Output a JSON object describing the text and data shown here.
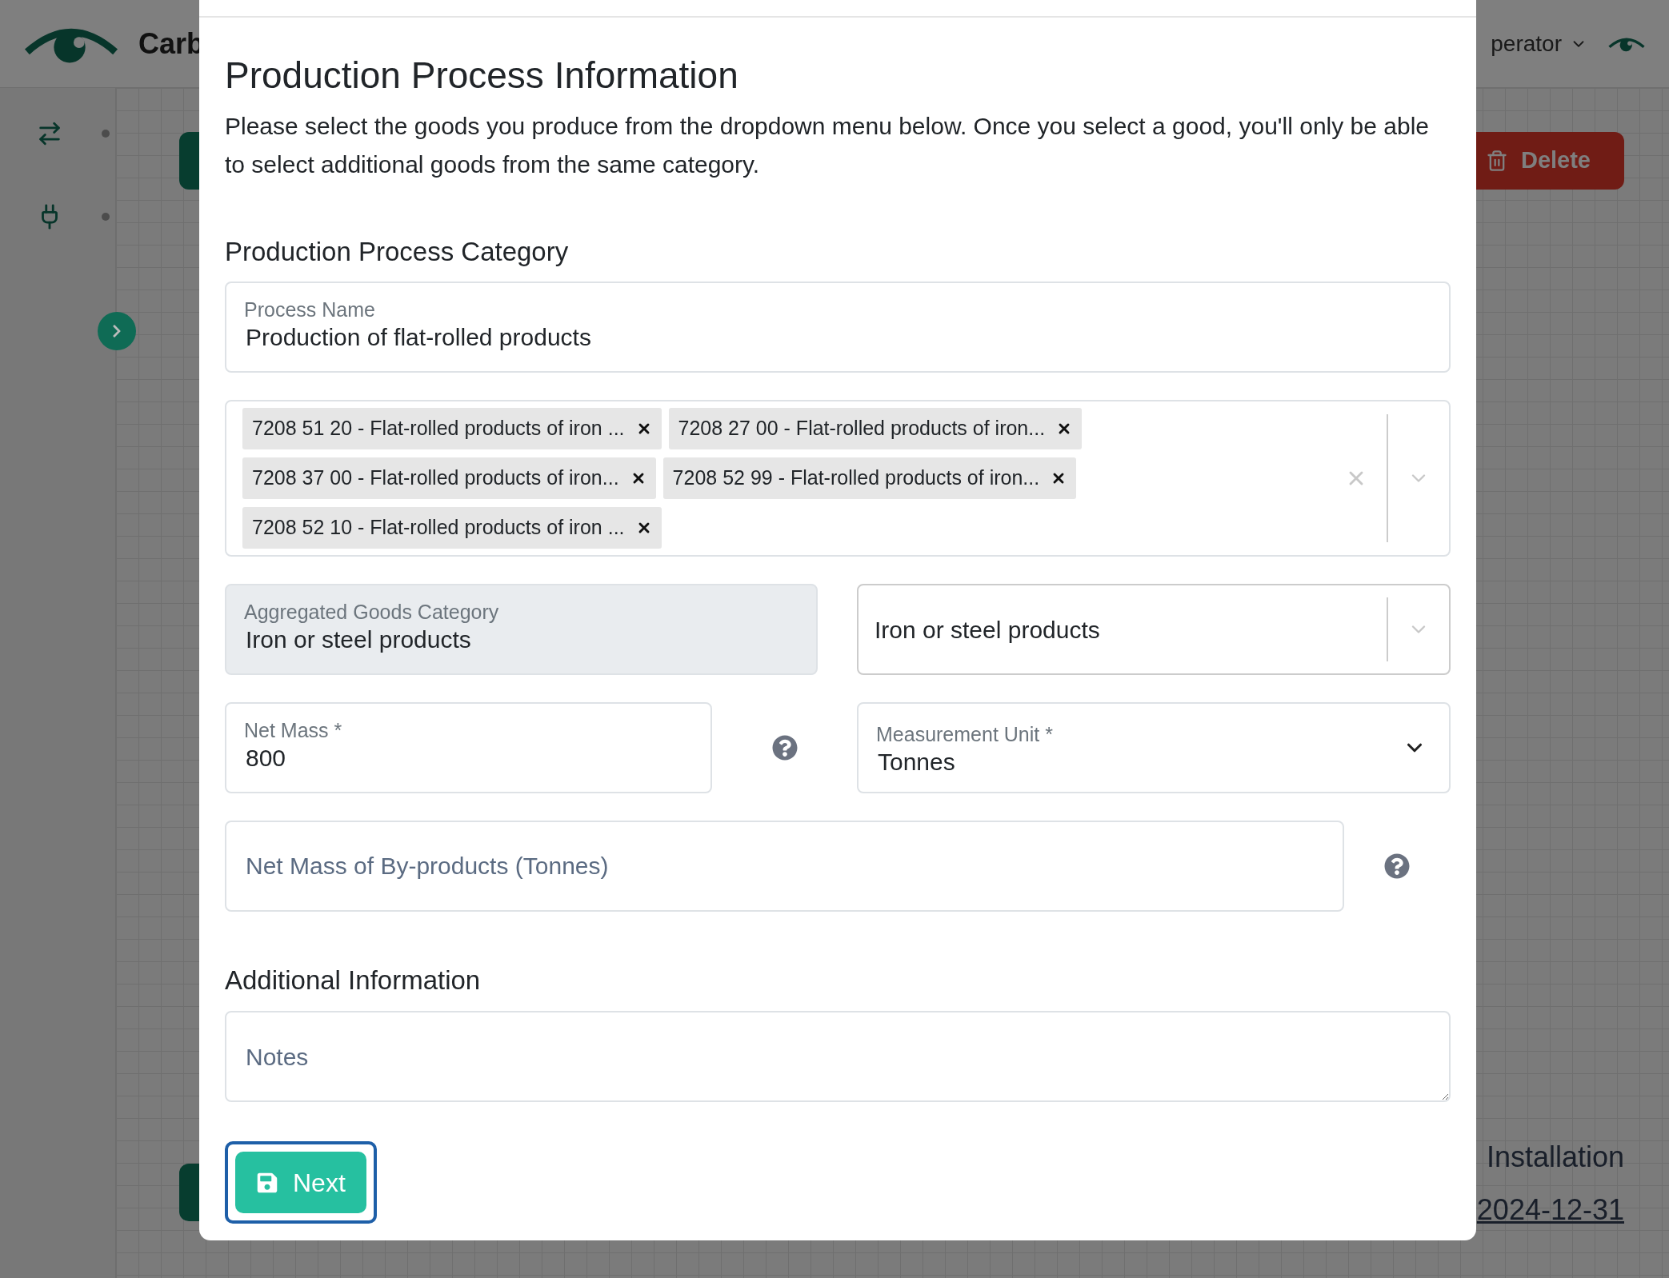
{
  "background": {
    "brand": "Carb",
    "user_menu": "perator",
    "delete_button": "Delete",
    "installation_label": "Installation",
    "date_link": "2024-12-31"
  },
  "modal": {
    "title": "Production Process Information",
    "description": "Please select the goods you produce from the dropdown menu below. Once you select a good, you'll only be able to select additional goods from the same category.",
    "category_heading": "Production Process Category",
    "process_name": {
      "label": "Process Name",
      "value": "Production of flat-rolled products"
    },
    "goods_tags": [
      "7208 51 20 - Flat-rolled products of iron ...",
      "7208 27 00 - Flat-rolled products of iron...",
      "7208 37 00 - Flat-rolled products of iron...",
      "7208 52 99 - Flat-rolled products of iron...",
      "7208 52 10 - Flat-rolled products of iron ..."
    ],
    "aggregated_category": {
      "label": "Aggregated Goods Category",
      "value": "Iron or steel products",
      "disabled": true
    },
    "category_select": {
      "value": "Iron or steel products"
    },
    "net_mass": {
      "label": "Net Mass *",
      "value": "800"
    },
    "measurement_unit": {
      "label": "Measurement Unit *",
      "value": "Tonnes"
    },
    "byproducts": {
      "placeholder": "Net Mass of By-products (Tonnes)"
    },
    "additional_heading": "Additional Information",
    "notes": {
      "placeholder": "Notes"
    },
    "next_button": {
      "label": "Next",
      "focused": true
    }
  }
}
